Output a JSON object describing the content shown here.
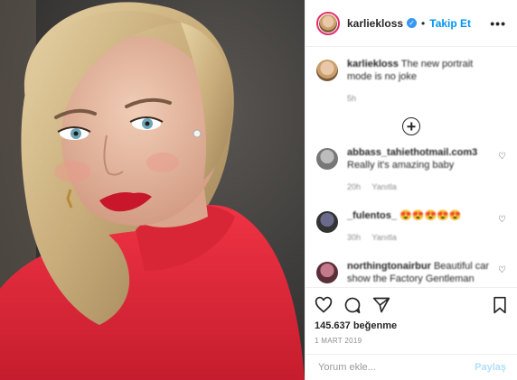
{
  "header": {
    "username": "karliekloss",
    "verified_glyph": "✓",
    "separator": "•",
    "follow_label": "Takip Et",
    "more_icon": "•••"
  },
  "caption": {
    "username": "karliekloss",
    "text": "The new portrait mode is no joke",
    "time": "5h"
  },
  "comments": [
    {
      "username": "abbass_tahiethotmail.com3",
      "text": "Really it's amazing baby",
      "time": "20h",
      "reply": "Yanıtla"
    },
    {
      "username": "_fulentos_",
      "text": "😍😍😍😍😍",
      "time": "30h",
      "reply": "Yanıtla"
    },
    {
      "username": "northingtonairbur",
      "text": "Beautiful car show the Factory Gentleman Club Ponekal Member xxxx Ponnts"
    }
  ],
  "likes": {
    "count": "145.637",
    "label": "beğenme"
  },
  "date": "1 MART 2019",
  "add_comment": {
    "placeholder": "Yorum ekle...",
    "submit_label": "Paylaş"
  },
  "colors": {
    "accent": "#0095f6",
    "dress": "#e02a3a",
    "hair": "#d8c08d"
  }
}
